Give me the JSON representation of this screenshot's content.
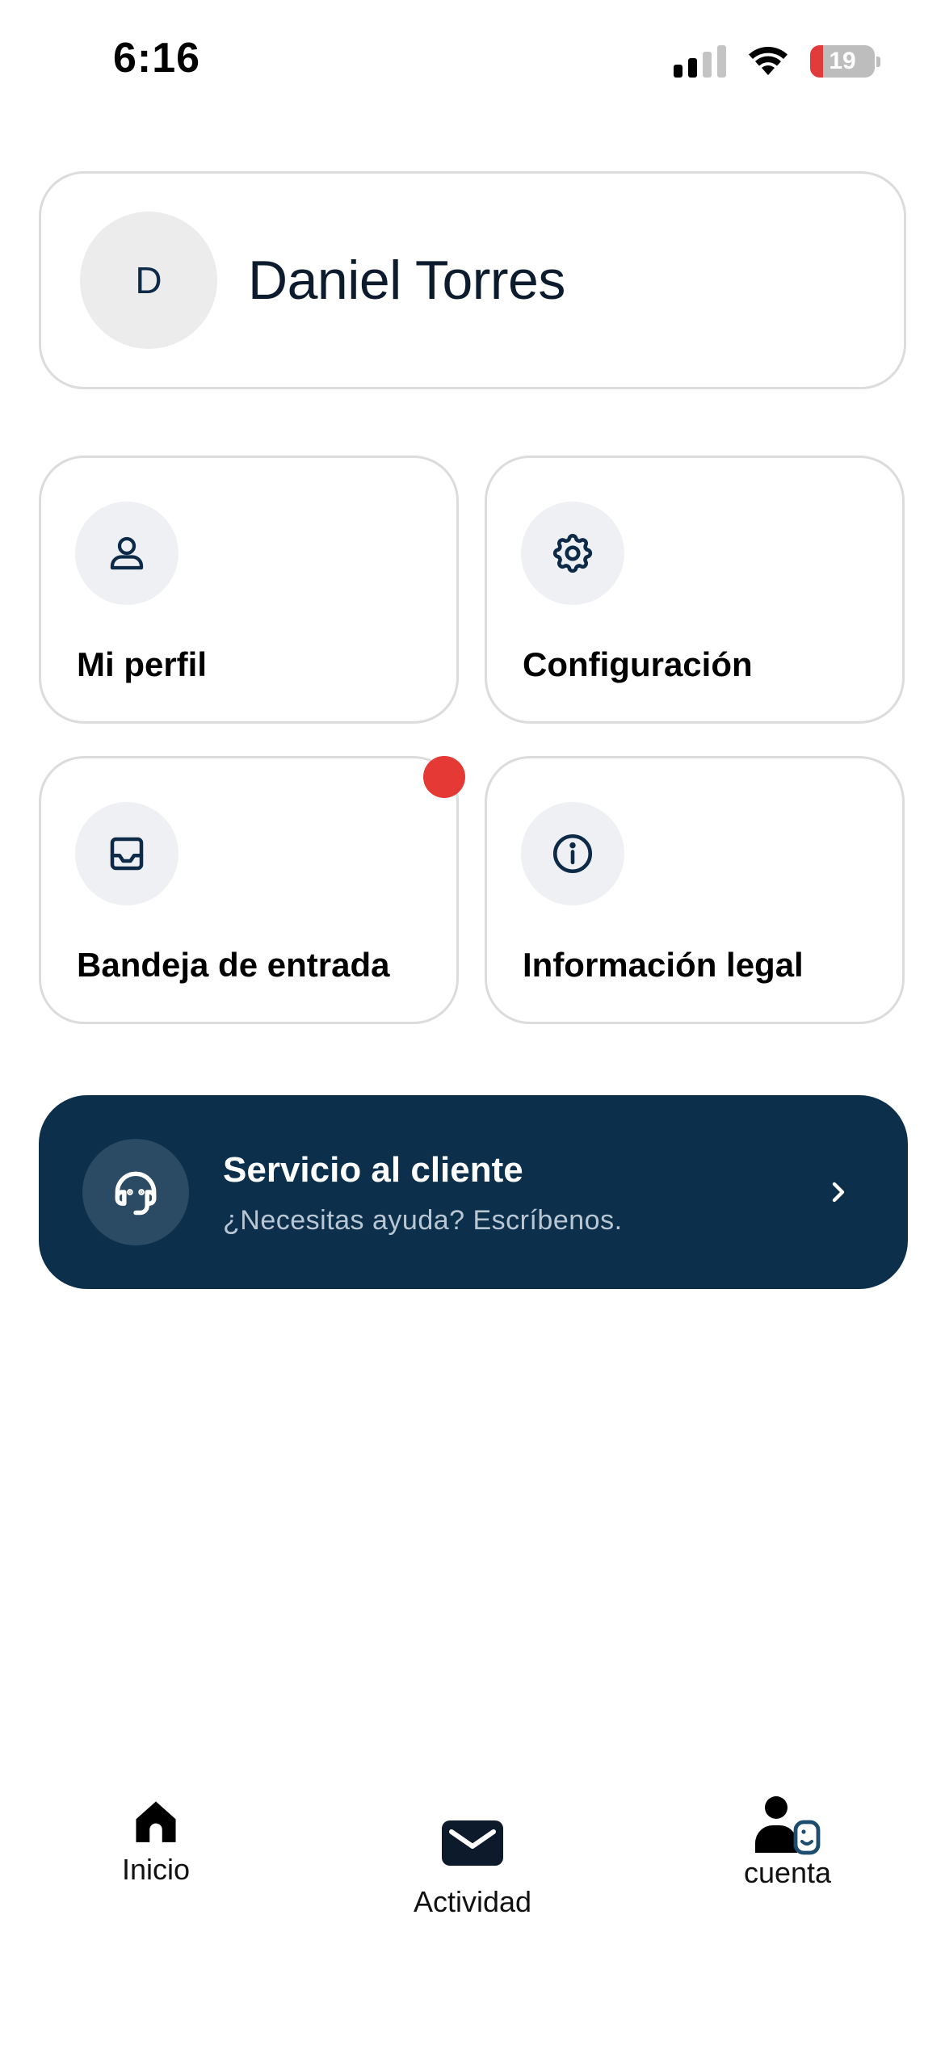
{
  "status_bar": {
    "time": "6:16",
    "battery_level": "19",
    "signal_bars_active": 2,
    "signal_bars_total": 4
  },
  "profile": {
    "initial": "D",
    "name": "Daniel Torres"
  },
  "tiles": [
    {
      "label": "Mi perfil",
      "icon": "person-icon"
    },
    {
      "label": "Configuración",
      "icon": "gear-icon"
    },
    {
      "label": "Bandeja de entrada",
      "icon": "inbox-icon",
      "has_badge": true
    },
    {
      "label": "Información legal",
      "icon": "info-icon"
    }
  ],
  "support": {
    "title": "Servicio al cliente",
    "subtitle": "¿Necesitas ayuda? Escríbenos.",
    "icon": "headset-icon"
  },
  "bottom_nav": {
    "items": [
      {
        "label": "Inicio",
        "icon": "home-icon"
      },
      {
        "label": "Actividad",
        "icon": "mail-icon"
      },
      {
        "label": "cuenta",
        "icon": "account-icon"
      }
    ]
  },
  "colors": {
    "primary_dark": "#0c2f4b",
    "badge_red": "#e53935",
    "tile_border": "#dcdcdc",
    "icon_bg": "#eef0f3"
  }
}
